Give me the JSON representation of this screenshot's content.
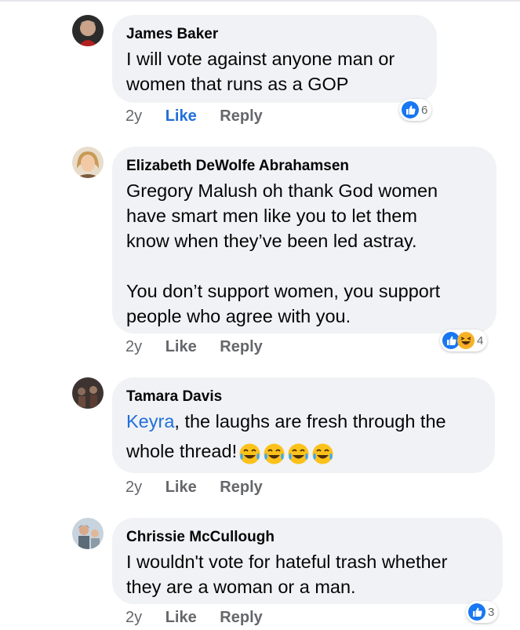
{
  "comments": [
    {
      "author": "James Baker",
      "text": "I will vote against anyone man or\nwomen that runs as a GOP",
      "time": "2y",
      "like_label": "Like",
      "reply_label": "Reply",
      "reaction_count": "6",
      "reactions": [
        "like-icon"
      ],
      "liked_by_viewer": true
    },
    {
      "author": "Elizabeth DeWolfe Abrahamsen",
      "text": "Gregory Malush  oh thank God women\nhave smart men like you to let them\nknow when they’ve been led astray.\n\nYou don’t support women, you support\npeople who agree with you.",
      "time": "2y",
      "like_label": "Like",
      "reply_label": "Reply",
      "reaction_count": "4",
      "reactions": [
        "like-icon",
        "haha-icon"
      ],
      "liked_by_viewer": false
    },
    {
      "author": "Tamara Davis",
      "mention": "Keyra",
      "text_line1_rest": ", the laughs are fresh through the",
      "text_line2": "whole thread!",
      "emojis": [
        "tears-of-joy-emoji",
        "tears-of-joy-emoji",
        "tears-of-joy-emoji",
        "tears-of-joy-emoji"
      ],
      "time": "2y",
      "like_label": "Like",
      "reply_label": "Reply",
      "liked_by_viewer": false
    },
    {
      "author": "Chrissie McCullough",
      "text": "I wouldn't vote for hateful trash whether\nthey are a woman or a man.",
      "time": "2y",
      "like_label": "Like",
      "reply_label": "Reply",
      "reaction_count": "3",
      "reactions": [
        "like-icon"
      ],
      "liked_by_viewer": false
    }
  ],
  "colors": {
    "bubble": "#f0f2f5",
    "link_blue": "#216fdb",
    "meta_gray": "#65676b",
    "like_blue": "#1877f2",
    "haha_yellow": "#f7b125"
  }
}
